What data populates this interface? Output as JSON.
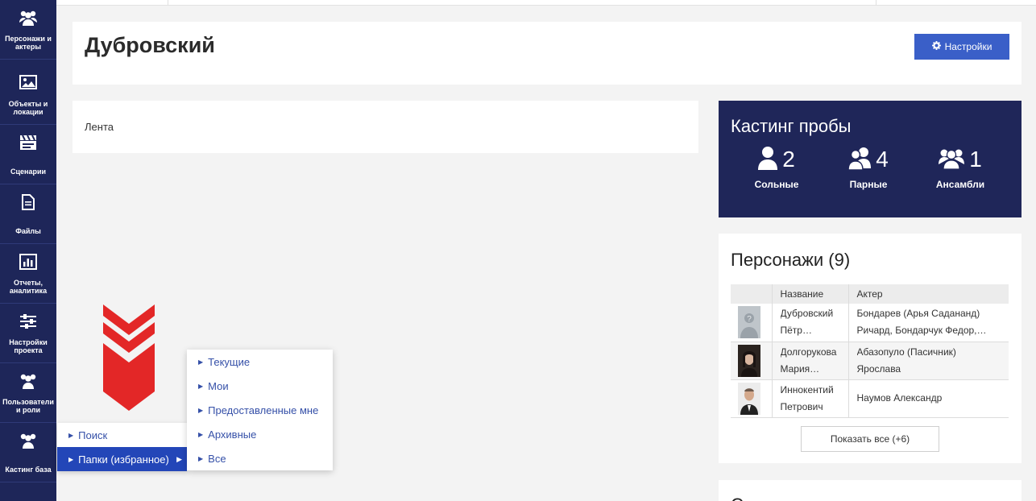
{
  "sidebar": {
    "items": [
      {
        "label": "Персонажи и актеры",
        "icon": "users-icon"
      },
      {
        "label": "Объекты и локации",
        "icon": "image-icon"
      },
      {
        "label": "Сценарии",
        "icon": "clapperboard-icon"
      },
      {
        "label": "Файлы",
        "icon": "file-icon"
      },
      {
        "label": "Отчеты, аналитика",
        "icon": "chart-icon"
      },
      {
        "label": "Настройки проекта",
        "icon": "sliders-icon"
      },
      {
        "label": "Пользователи и роли",
        "icon": "users-icon"
      },
      {
        "label": "Кастинг база",
        "icon": "users-icon"
      }
    ]
  },
  "header": {
    "title": "Дубровский",
    "settings_label": "Настройки"
  },
  "feed": {
    "label": "Лента"
  },
  "casting": {
    "title": "Кастинг пробы",
    "stats": [
      {
        "count": "2",
        "label": "Сольные",
        "icon": "user-icon"
      },
      {
        "count": "4",
        "label": "Парные",
        "icon": "user-pair-icon"
      },
      {
        "count": "1",
        "label": "Ансамбли",
        "icon": "user-group-icon"
      }
    ]
  },
  "characters": {
    "title": "Персонажи (9)",
    "columns": [
      "",
      "Название",
      "Актер"
    ],
    "rows": [
      {
        "name1": "Дубровский",
        "name2": "Пётр…",
        "actor1": "Бондарев (Арья Садананд)",
        "actor2": "Ричард, Бондарчук Федор,…",
        "photo": "placeholder"
      },
      {
        "name1": "Долгорукова",
        "name2": "Мария…",
        "actor1": "Абазопуло (Пасичник)",
        "actor2": "Ярослава",
        "photo": "woman"
      },
      {
        "name1": "Иннокентий",
        "name2": "Петрович",
        "actor1": "Наумов Александр",
        "actor2": "",
        "photo": "man"
      }
    ],
    "show_all": "Показать все (+6)"
  },
  "next_section": {
    "title_partial": "С"
  },
  "menu": {
    "items": [
      {
        "label": "Поиск"
      },
      {
        "label": "Папки (избранное)"
      }
    ],
    "submenu": [
      {
        "label": "Текущие"
      },
      {
        "label": "Мои"
      },
      {
        "label": "Предоставленные мне"
      },
      {
        "label": "Архивные"
      },
      {
        "label": "Все"
      }
    ]
  },
  "colors": {
    "sidebar": "#1e2659",
    "accent": "#3a5fc8",
    "logo_red": "#e32727"
  }
}
